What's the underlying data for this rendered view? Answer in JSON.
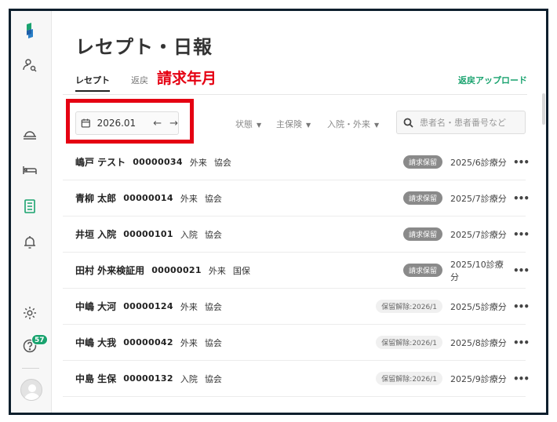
{
  "page": {
    "title": "レセプト・日報",
    "tabs": [
      "レセプト",
      "返戻"
    ],
    "annotation": "請求年月",
    "upload_label": "返戻アップロード"
  },
  "sidebar": {
    "badge_count": "57",
    "icons": [
      "logo-icon",
      "patient-search-icon",
      "reception-icon",
      "bed-icon",
      "receipt-list-icon",
      "bell-icon",
      "settings-icon",
      "help-icon",
      "avatar"
    ],
    "active_color": "#1aa36f"
  },
  "filters": {
    "billing_month": "2026.01",
    "status_label": "状態",
    "insurance_label": "主保険",
    "visit_label": "入院・外来",
    "search_placeholder": "患者名・患者番号など"
  },
  "rows": [
    {
      "name": "嶋戸 テスト",
      "id": "00000034",
      "type": "外来",
      "insurance": "協会",
      "badge": "請求保留",
      "badge_kind": "hold",
      "month": "2025/6診療分"
    },
    {
      "name": "青柳 太郎",
      "id": "00000014",
      "type": "外来",
      "insurance": "協会",
      "badge": "請求保留",
      "badge_kind": "hold",
      "month": "2025/7診療分"
    },
    {
      "name": "井垣 入院",
      "id": "00000101",
      "type": "入院",
      "insurance": "協会",
      "badge": "請求保留",
      "badge_kind": "hold",
      "month": "2025/7診療分"
    },
    {
      "name": "田村 外来検証用",
      "id": "00000021",
      "type": "外来",
      "insurance": "国保",
      "badge": "請求保留",
      "badge_kind": "hold",
      "month": "2025/10診療分"
    },
    {
      "name": "中嶋 大河",
      "id": "00000124",
      "type": "外来",
      "insurance": "協会",
      "badge": "保留解除:2026/1",
      "badge_kind": "release",
      "month": "2025/5診療分"
    },
    {
      "name": "中嶋 大我",
      "id": "00000042",
      "type": "外来",
      "insurance": "協会",
      "badge": "保留解除:2026/1",
      "badge_kind": "release",
      "month": "2025/8診療分"
    },
    {
      "name": "中島 生保",
      "id": "00000132",
      "type": "入院",
      "insurance": "協会",
      "badge": "保留解除:2026/1",
      "badge_kind": "release",
      "month": "2025/9診療分"
    }
  ]
}
